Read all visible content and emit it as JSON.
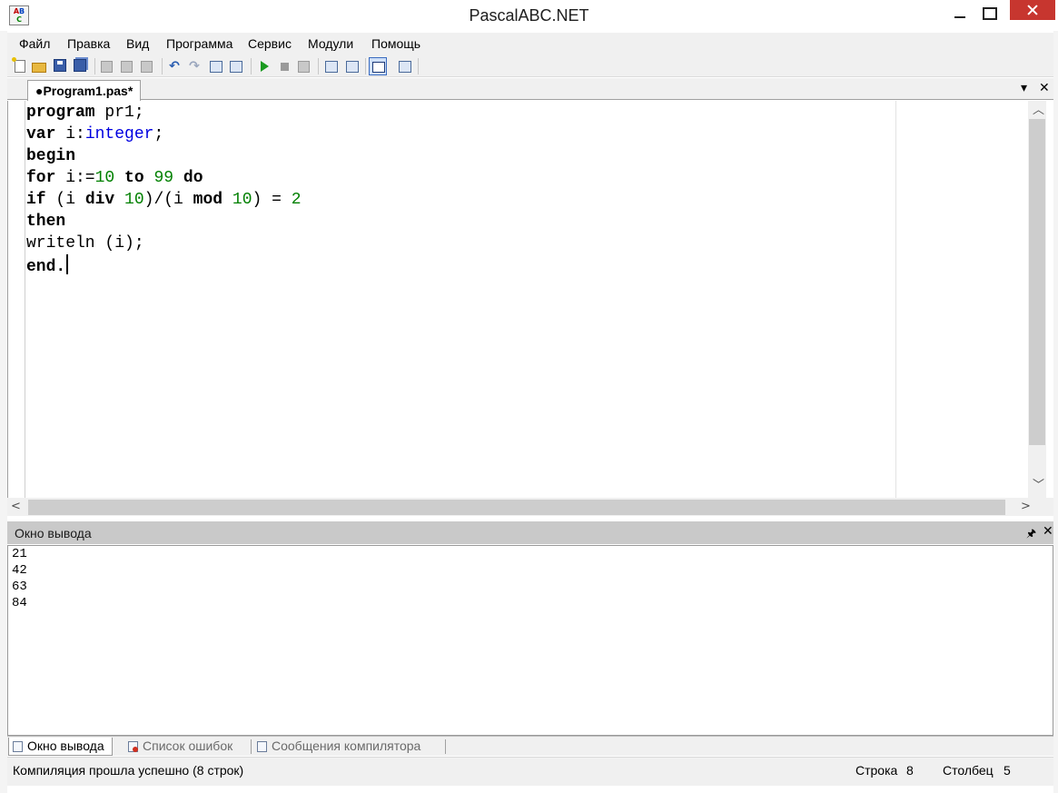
{
  "window": {
    "title": "PascalABC.NET",
    "icon": "abc-app-icon"
  },
  "menu": [
    "Файл",
    "Правка",
    "Вид",
    "Программа",
    "Сервис",
    "Модули",
    "Помощь"
  ],
  "toolbar": {
    "icons": [
      "new-file-icon",
      "open-file-icon",
      "save-icon",
      "save-all-icon",
      "cut-icon",
      "copy-icon",
      "paste-icon",
      "undo-icon",
      "redo-icon",
      "indent-icon",
      "unindent-icon",
      "run-icon",
      "stop-icon",
      "debug-icon",
      "step-into-icon",
      "step-over-icon",
      "output-window-toggle-icon",
      "settings-icon"
    ]
  },
  "editor": {
    "tab_label": "●Program1.pas*",
    "lines": [
      [
        {
          "t": "program",
          "c": "kw"
        },
        {
          "t": " pr1;",
          "c": ""
        }
      ],
      [
        {
          "t": "var",
          "c": "kw"
        },
        {
          "t": " i:",
          "c": ""
        },
        {
          "t": "integer",
          "c": "ty"
        },
        {
          "t": ";",
          "c": ""
        }
      ],
      [
        {
          "t": "begin",
          "c": "kw"
        }
      ],
      [
        {
          "t": "for",
          "c": "kw"
        },
        {
          "t": " i:=",
          "c": ""
        },
        {
          "t": "10",
          "c": "num"
        },
        {
          "t": " ",
          "c": ""
        },
        {
          "t": "to",
          "c": "kw"
        },
        {
          "t": " ",
          "c": ""
        },
        {
          "t": "99",
          "c": "num"
        },
        {
          "t": " ",
          "c": ""
        },
        {
          "t": "do",
          "c": "kw"
        }
      ],
      [
        {
          "t": "if",
          "c": "kw"
        },
        {
          "t": " (i ",
          "c": ""
        },
        {
          "t": "div",
          "c": "kw"
        },
        {
          "t": " ",
          "c": ""
        },
        {
          "t": "10",
          "c": "num"
        },
        {
          "t": ")/(i ",
          "c": ""
        },
        {
          "t": "mod",
          "c": "kw"
        },
        {
          "t": " ",
          "c": ""
        },
        {
          "t": "10",
          "c": "num"
        },
        {
          "t": ") = ",
          "c": ""
        },
        {
          "t": "2",
          "c": "num"
        }
      ],
      [
        {
          "t": "then",
          "c": "kw"
        }
      ],
      [
        {
          "t": "writeln (i);",
          "c": ""
        }
      ],
      [
        {
          "t": "end.",
          "c": "kw"
        }
      ]
    ]
  },
  "output_panel": {
    "title": "Окно вывода",
    "lines": [
      "21",
      "42",
      "63",
      "84"
    ]
  },
  "bottom_tabs": [
    "Окно вывода",
    "Список ошибок",
    "Сообщения компилятора"
  ],
  "status": {
    "message": "Компиляция прошла успешно (8 строк)",
    "row_label": "Строка",
    "row_value": "8",
    "col_label": "Столбец",
    "col_value": "5"
  }
}
